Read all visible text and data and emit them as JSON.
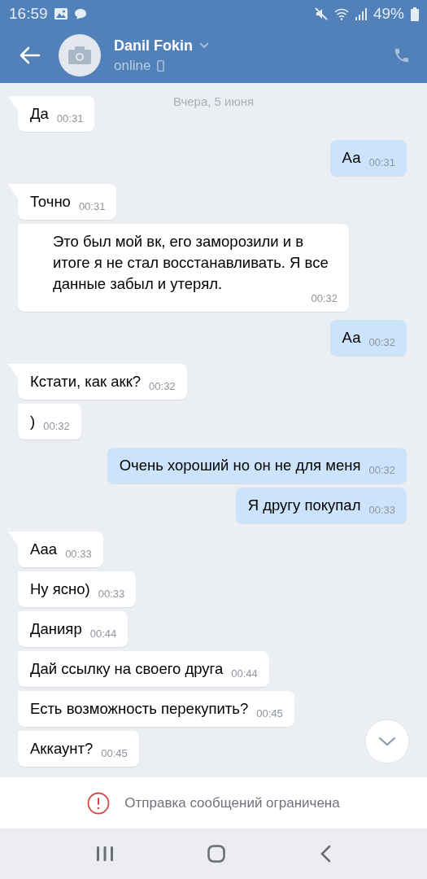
{
  "status_bar": {
    "time": "16:59",
    "battery": "49%"
  },
  "header": {
    "name": "Danil Fokin",
    "status": "online"
  },
  "date_label": "Вчера, 5 июня",
  "messages": [
    {
      "kind": "in",
      "tail": true,
      "text": "Да",
      "time": "00:31"
    },
    {
      "kind": "out",
      "tail": false,
      "text": "Аа",
      "time": "00:31"
    },
    {
      "kind": "in",
      "tail": true,
      "text": "Точно",
      "time": "00:31"
    },
    {
      "kind": "in",
      "tail": false,
      "text": "Это был мой вк, его заморозили и в итоге я не стал восстанавливать. Я все данные забыл и утерял.",
      "time": "00:32"
    },
    {
      "kind": "out",
      "tail": false,
      "text": "Аа",
      "time": "00:32"
    },
    {
      "kind": "in",
      "tail": true,
      "text": "Кстати, как акк?",
      "time": "00:32"
    },
    {
      "kind": "in",
      "tail": false,
      "text": ")",
      "time": "00:32"
    },
    {
      "kind": "out",
      "tail": false,
      "text": "Очень хороший но он не для меня",
      "time": "00:32"
    },
    {
      "kind": "out",
      "tail": false,
      "text": "Я другу покупал",
      "time": "00:33"
    },
    {
      "kind": "in",
      "tail": true,
      "text": "Ааа",
      "time": "00:33"
    },
    {
      "kind": "in",
      "tail": false,
      "text": "Ну ясно)",
      "time": "00:33"
    },
    {
      "kind": "in",
      "tail": false,
      "text": "Данияр",
      "time": "00:44"
    },
    {
      "kind": "in",
      "tail": false,
      "text": "Дай ссылку на своего друга",
      "time": "00:44"
    },
    {
      "kind": "in",
      "tail": false,
      "text": "Есть возможность перекупить?",
      "time": "00:45"
    },
    {
      "kind": "in",
      "tail": false,
      "text": "Аккаунт?",
      "time": "00:45"
    }
  ],
  "restriction_notice": "Отправка сообщений ограничена"
}
